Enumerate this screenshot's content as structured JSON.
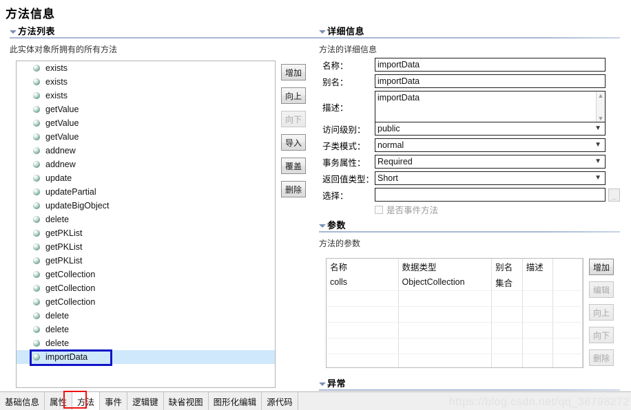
{
  "page": {
    "title": "方法信息"
  },
  "method_list_section": {
    "heading": "方法列表",
    "description": "此实体对象所拥有的所有方法",
    "items": [
      {
        "label": "exists",
        "icon": "method-sphere-icon",
        "selected": false
      },
      {
        "label": "exists",
        "icon": "method-sphere-icon",
        "selected": false
      },
      {
        "label": "exists",
        "icon": "method-sphere-icon",
        "selected": false
      },
      {
        "label": "getValue",
        "icon": "method-sphere-icon",
        "selected": false
      },
      {
        "label": "getValue",
        "icon": "method-sphere-icon",
        "selected": false
      },
      {
        "label": "getValue",
        "icon": "method-sphere-icon",
        "selected": false
      },
      {
        "label": "addnew",
        "icon": "method-sphere-icon",
        "selected": false
      },
      {
        "label": "addnew",
        "icon": "method-sphere-icon",
        "selected": false
      },
      {
        "label": "update",
        "icon": "method-sphere-icon",
        "selected": false
      },
      {
        "label": "updatePartial",
        "icon": "method-sphere-icon",
        "selected": false
      },
      {
        "label": "updateBigObject",
        "icon": "method-sphere-icon",
        "selected": false
      },
      {
        "label": "delete",
        "icon": "method-sphere-icon",
        "selected": false
      },
      {
        "label": "getPKList",
        "icon": "method-sphere-icon",
        "selected": false
      },
      {
        "label": "getPKList",
        "icon": "method-sphere-icon",
        "selected": false
      },
      {
        "label": "getPKList",
        "icon": "method-sphere-icon",
        "selected": false
      },
      {
        "label": "getCollection",
        "icon": "method-sphere-icon",
        "selected": false
      },
      {
        "label": "getCollection",
        "icon": "method-sphere-icon",
        "selected": false
      },
      {
        "label": "getCollection",
        "icon": "method-sphere-icon",
        "selected": false
      },
      {
        "label": "delete",
        "icon": "method-sphere-icon",
        "selected": false
      },
      {
        "label": "delete",
        "icon": "method-sphere-icon",
        "selected": false
      },
      {
        "label": "delete",
        "icon": "method-sphere-icon",
        "selected": false
      },
      {
        "label": "importData",
        "icon": "method-sphere-icon",
        "selected": true
      }
    ],
    "buttons": [
      {
        "label": "增加",
        "name": "add-method-button",
        "disabled": false
      },
      {
        "label": "向上",
        "name": "move-up-method-button",
        "disabled": false
      },
      {
        "label": "向下",
        "name": "move-down-method-button",
        "disabled": true
      },
      {
        "label": "导入",
        "name": "import-method-button",
        "disabled": false
      },
      {
        "label": "覆盖",
        "name": "override-method-button",
        "disabled": false
      },
      {
        "label": "删除",
        "name": "delete-method-button",
        "disabled": false
      }
    ]
  },
  "detail_section": {
    "heading": "详细信息",
    "description": "方法的详细信息",
    "fields": {
      "name_label": "名称：",
      "name_value": "importData",
      "alias_label": "别名：",
      "alias_value": "importData",
      "desc_label": "描述：",
      "desc_value": "importData",
      "access_label": "访问级别：",
      "access_value": "public",
      "subclass_label": "子类模式：",
      "subclass_value": "normal",
      "transaction_label": "事务属性：",
      "transaction_value": "Required",
      "return_label": "返回值类型：",
      "return_value": "Short",
      "choose_label": "选择：",
      "choose_value": "",
      "browse_label": "...",
      "is_event_label": "是否事件方法",
      "is_event_checked": false
    },
    "scroll_up_glyph": "▲",
    "scroll_down_glyph": "▼",
    "dropdown_glyph": "▼"
  },
  "params_section": {
    "heading": "参数",
    "description": "方法的参数",
    "columns": [
      "名称",
      "数据类型",
      "别名",
      "描述",
      ""
    ],
    "rows": [
      [
        "colls",
        "ObjectCollection",
        "集合",
        "",
        ""
      ],
      [
        "",
        "",
        "",
        "",
        ""
      ],
      [
        "",
        "",
        "",
        "",
        ""
      ],
      [
        "",
        "",
        "",
        "",
        ""
      ],
      [
        "",
        "",
        "",
        "",
        ""
      ],
      [
        "",
        "",
        "",
        "",
        ""
      ]
    ],
    "buttons": [
      {
        "label": "增加",
        "name": "add-param-button",
        "disabled": false
      },
      {
        "label": "编辑",
        "name": "edit-param-button",
        "disabled": true
      },
      {
        "label": "向上",
        "name": "move-up-param-button",
        "disabled": true
      },
      {
        "label": "向下",
        "name": "move-down-param-button",
        "disabled": true
      },
      {
        "label": "删除",
        "name": "delete-param-button",
        "disabled": true
      }
    ]
  },
  "exception_section": {
    "heading": "异常"
  },
  "tabs": [
    {
      "label": "基础信息",
      "active": false
    },
    {
      "label": "属性",
      "active": false
    },
    {
      "label": "方法",
      "active": true
    },
    {
      "label": "事件",
      "active": false
    },
    {
      "label": "逻辑键",
      "active": false
    },
    {
      "label": "缺省视图",
      "active": false
    },
    {
      "label": "图形化编辑",
      "active": false
    },
    {
      "label": "源代码",
      "active": false
    }
  ],
  "watermark": {
    "text": "https://blog.csdn.net/qq_36798272"
  },
  "colors": {
    "selection": "#cfe8fb",
    "section_rule": "#a8b8d4",
    "annotation_blue": "#1114c8",
    "annotation_red": "#ee1111",
    "watermark": "#e2e2e2"
  }
}
